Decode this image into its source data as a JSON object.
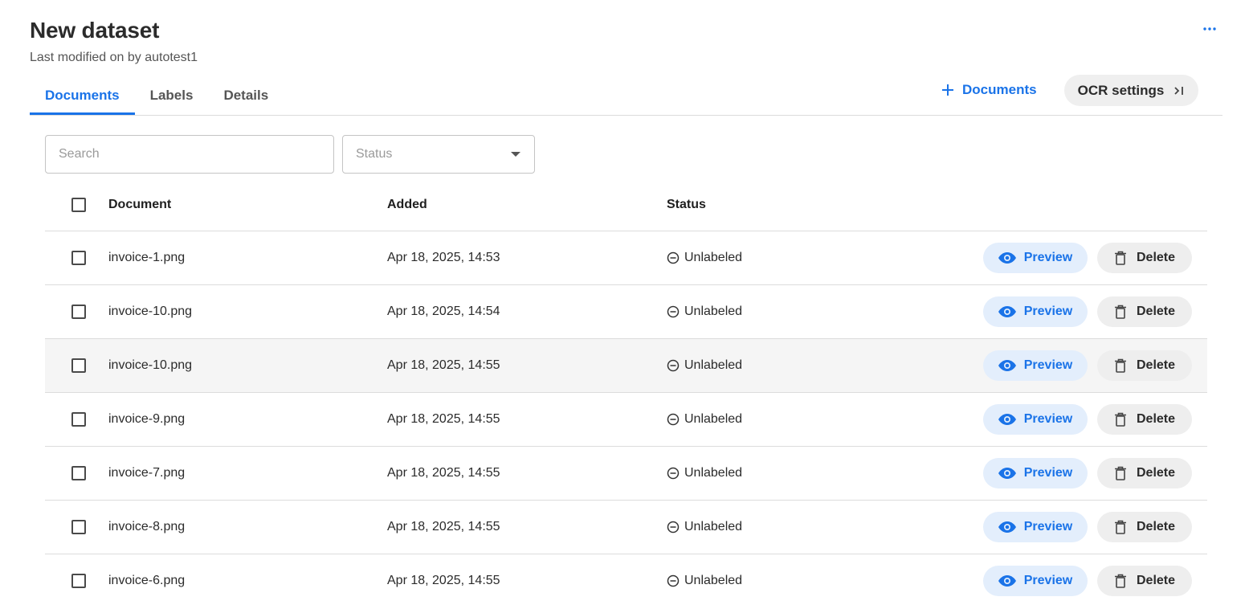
{
  "header": {
    "title": "New dataset",
    "subtitle": "Last modified on by autotest1",
    "more_icon": "more-horizontal-icon"
  },
  "tabs": [
    {
      "label": "Documents",
      "active": true
    },
    {
      "label": "Labels",
      "active": false
    },
    {
      "label": "Details",
      "active": false
    }
  ],
  "actions": {
    "add_documents_label": "Documents",
    "add_icon": "plus-icon",
    "ocr_settings_label": "OCR settings",
    "ocr_icon": "chevron-right-bar-icon"
  },
  "filters": {
    "search_placeholder": "Search",
    "status_placeholder": "Status"
  },
  "table": {
    "columns": [
      "Document",
      "Added",
      "Status"
    ],
    "preview_label": "Preview",
    "delete_label": "Delete",
    "rows": [
      {
        "document": "invoice-1.png",
        "added": "Apr 18, 2025, 14:53",
        "status": "Unlabeled"
      },
      {
        "document": "invoice-10.png",
        "added": "Apr 18, 2025, 14:54",
        "status": "Unlabeled"
      },
      {
        "document": "invoice-10.png",
        "added": "Apr 18, 2025, 14:55",
        "status": "Unlabeled"
      },
      {
        "document": "invoice-9.png",
        "added": "Apr 18, 2025, 14:55",
        "status": "Unlabeled"
      },
      {
        "document": "invoice-7.png",
        "added": "Apr 18, 2025, 14:55",
        "status": "Unlabeled"
      },
      {
        "document": "invoice-8.png",
        "added": "Apr 18, 2025, 14:55",
        "status": "Unlabeled"
      },
      {
        "document": "invoice-6.png",
        "added": "Apr 18, 2025, 14:55",
        "status": "Unlabeled"
      }
    ]
  },
  "colors": {
    "accent": "#1a73e8",
    "preview_bg": "#e3eefc",
    "hover_row": "#f5f5f5"
  }
}
